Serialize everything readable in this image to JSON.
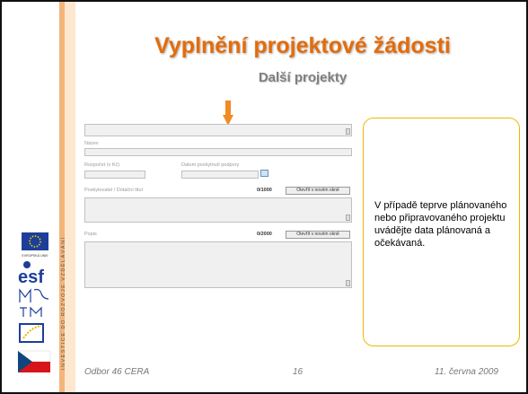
{
  "slide": {
    "title": "Vyplnění projektové žádosti",
    "subtitle": "Další projekty",
    "vertical_strip_text": "INVESTICE DO ROZVOJE VZDĚLÁVÁNÍ",
    "footer": {
      "left": "Odbor 46 CERA",
      "center": "16",
      "right": "11. června 2009"
    }
  },
  "form": {
    "name_label": "Název",
    "budget_label": "Rozpočet (v Kč)",
    "support_date_label": "Datum poskytnutí podpory",
    "provider_label": "Poskytovatel / Dotační titul",
    "provider_counter": "0/1000",
    "open_window_label_1": "Otevřít v novém okně",
    "description_label": "Popis",
    "description_counter": "0/2000",
    "open_window_label_2": "Otevřít v novém okně"
  },
  "callout": {
    "text": "V případě teprve plánovaného nebo připravovaného projektu uvádějte data plánovaná a očekávaná."
  },
  "logos": {
    "eu_caption": "EVROPSKÁ UNIE",
    "esf": "esf",
    "msmt": "MŠMT"
  },
  "colors": {
    "title": "#e46c0a",
    "subtitle": "#7f7f7f",
    "callout_border": "#f2b600",
    "strip": "#f3b57b"
  }
}
